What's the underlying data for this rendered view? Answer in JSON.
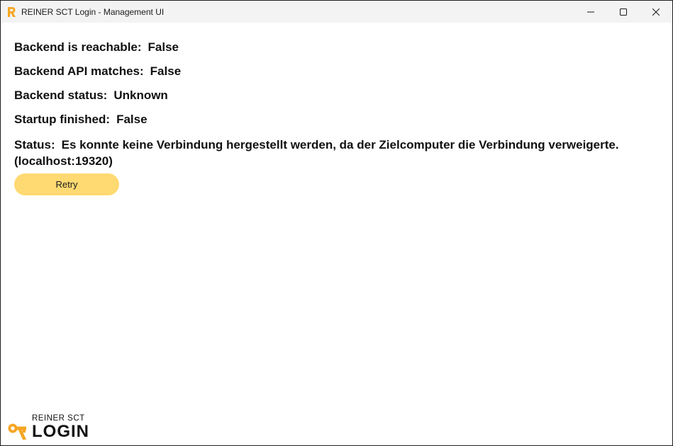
{
  "window": {
    "title": "REINER SCT Login - Management UI",
    "controls": {
      "minimize_icon": "minimize-icon",
      "maximize_icon": "maximize-icon",
      "close_icon": "close-icon"
    }
  },
  "status_rows": [
    {
      "label": "Backend is reachable:",
      "value": "False"
    },
    {
      "label": "Backend API matches:",
      "value": "False"
    },
    {
      "label": "Backend status:",
      "value": "Unknown"
    },
    {
      "label": "Startup finished:",
      "value": "False"
    }
  ],
  "status": {
    "label": "Status:",
    "value": "Es konnte keine Verbindung hergestellt werden, da der Zielcomputer die Verbindung verweigerte. (localhost:19320)"
  },
  "retry_label": "Retry",
  "brand": {
    "top": "REINER SCT",
    "bottom": "LOGIN"
  },
  "colors": {
    "accent": "#ffd971",
    "brand_orange": "#f5a623",
    "titlebar": "#f3f3f3"
  }
}
